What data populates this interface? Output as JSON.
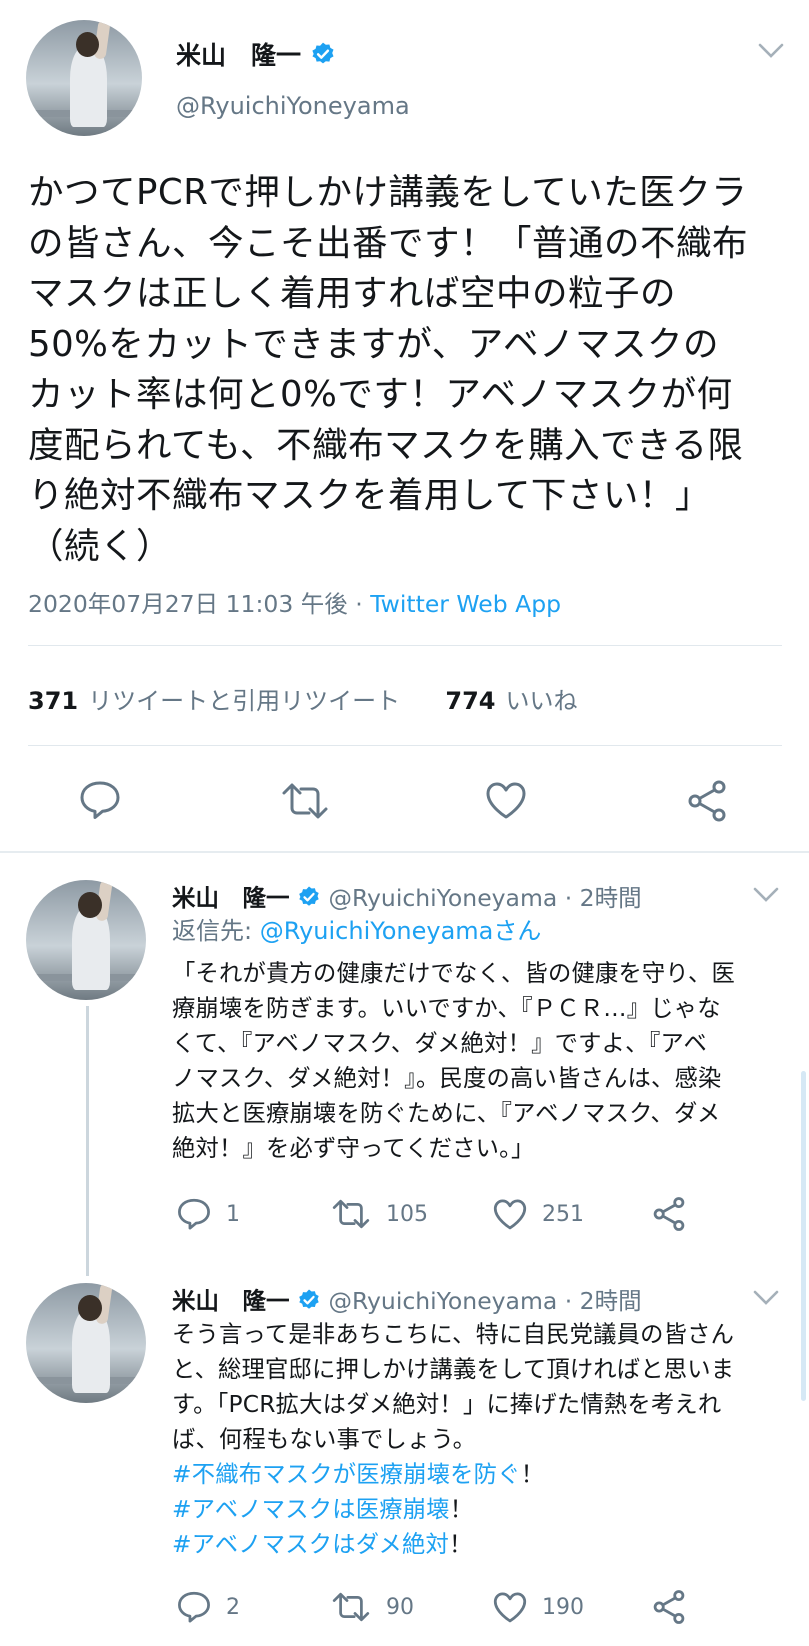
{
  "tweet": {
    "name": "米山　隆一",
    "handle": "@RyuichiYoneyama",
    "lines": [
      "かつてPCRで押しかけ講義をしていた医クラ",
      "の皆さん、今こそ出番です！「普通の不織布",
      "マスクは正しく着用すれば空中の粒子の",
      "50%をカットできますが、アベノマスクの",
      "カット率は何と0%です！アベノマスクが何",
      "度配られても、不織布マスクを購入できる限",
      "り絶対不織布マスクを着用して下さい！」",
      "（続く）"
    ],
    "timestamp": "2020年07月27日 11:03 午後 · ",
    "client": "Twitter Web App",
    "retweets_count": "371",
    "retweets_label": "リツイートと引用リツイート",
    "likes_count": "774",
    "likes_label": "いいね"
  },
  "replies": [
    {
      "name": "米山　隆一",
      "handle": "@RyuichiYoneyama · 2時間",
      "reply_to_label": "返信先: ",
      "reply_to_handle": "@RyuichiYoneyamaさん",
      "lines": [
        "「それが貴方の健康だけでなく、皆の健康を守り、医",
        "療崩壊を防ぎます。いいですか、『ＰＣＲ…』じゃな",
        "くて、『アベノマスク、ダメ絶対！』ですよ、『アベ",
        "ノマスク、ダメ絶対！』。民度の高い皆さんは、感染",
        "拡大と医療崩壊を防ぐために、『アベノマスク、ダメ",
        "絶対！』を必ず守ってください。」"
      ],
      "replies": "1",
      "retweets": "105",
      "likes": "251"
    },
    {
      "name": "米山　隆一",
      "handle": "@RyuichiYoneyama · 2時間",
      "lines": [
        "そう言って是非あちこちに、特に自民党議員の皆さん",
        "と、総理官邸に押しかけ講義をして頂ければと思いま",
        "す。「PCR拡大はダメ絶対！」に捧げた情熱を考えれ",
        "ば、何程もない事でしょう。"
      ],
      "hashtags": [
        {
          "tag": "#不織布マスクが医療崩壊を防ぐ",
          "suffix": "！"
        },
        {
          "tag": "#アベノマスクは医療崩壊",
          "suffix": "！"
        },
        {
          "tag": "#アベノマスクはダメ絶対",
          "suffix": "！"
        }
      ],
      "replies": "2",
      "retweets": "90",
      "likes": "190"
    }
  ],
  "icons": [
    "verified-badge-icon",
    "chevron-down-icon",
    "reply-icon",
    "retweet-icon",
    "like-icon",
    "share-icon"
  ],
  "colors": {
    "accent": "#1da1f2",
    "muted": "#657786",
    "text": "#14171a"
  }
}
